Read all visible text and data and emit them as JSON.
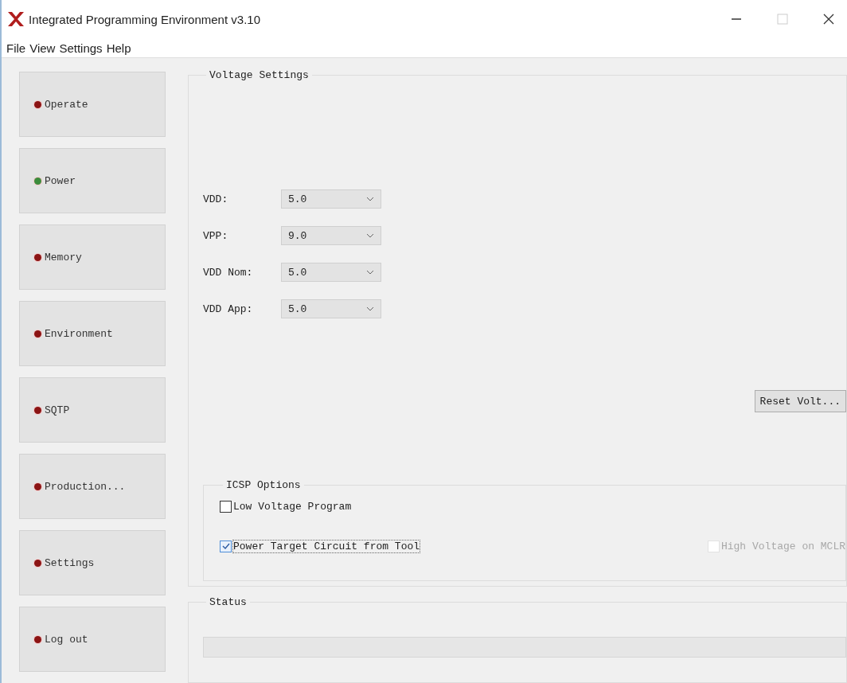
{
  "window": {
    "title": "Integrated Programming Environment v3.10"
  },
  "menu": [
    "File",
    "View",
    "Settings",
    "Help"
  ],
  "sidebar": {
    "items": [
      {
        "label": "Operate",
        "color": "#8b1414"
      },
      {
        "label": "Power",
        "color": "#3c8c3c"
      },
      {
        "label": "Memory",
        "color": "#8b1414"
      },
      {
        "label": "Environment",
        "color": "#8b1414"
      },
      {
        "label": "SQTP",
        "color": "#8b1414"
      },
      {
        "label": "Production...",
        "color": "#8b1414"
      },
      {
        "label": "Settings",
        "color": "#8b1414"
      },
      {
        "label": "Log out",
        "color": "#8b1414"
      }
    ]
  },
  "voltage_settings": {
    "title": "Voltage Settings",
    "fields": [
      {
        "label": "VDD:",
        "value": "5.0"
      },
      {
        "label": "VPP:",
        "value": "9.0"
      },
      {
        "label": "VDD Nom:",
        "value": "5.0"
      },
      {
        "label": "VDD App:",
        "value": "5.0"
      }
    ],
    "reset_button": "Reset Volt..."
  },
  "icsp_options": {
    "title": "ICSP Options",
    "options": [
      {
        "label": "Low Voltage Program",
        "checked": false,
        "disabled": false,
        "focused": false
      },
      {
        "label": "Power Target Circuit from Tool",
        "checked": true,
        "disabled": false,
        "focused": true
      },
      {
        "label": "High Voltage on MCLR",
        "checked": false,
        "disabled": true,
        "focused": false
      }
    ]
  },
  "status": {
    "title": "Status",
    "progress": {
      "level": 0
    }
  }
}
